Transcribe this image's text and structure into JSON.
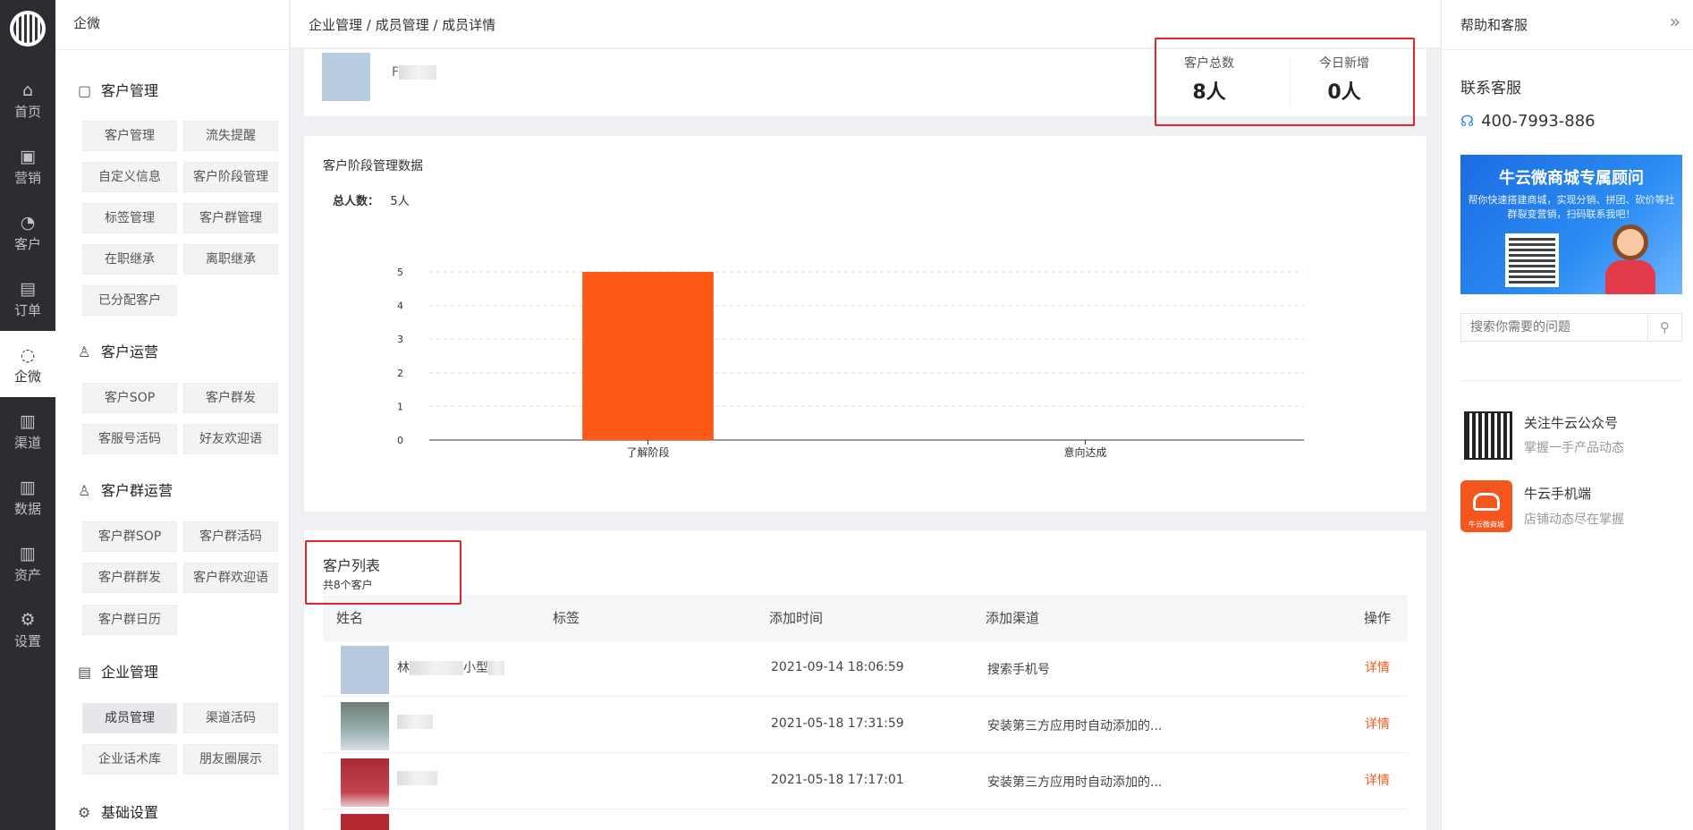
{
  "rail": {
    "items": [
      "首页",
      "营销",
      "客户",
      "订单",
      "企微",
      "渠道",
      "数据",
      "资产",
      "设置"
    ]
  },
  "menu": {
    "title": "企微",
    "groups": [
      {
        "title": "客户管理",
        "items": [
          "客户管理",
          "流失提醒",
          "自定义信息",
          "客户阶段管理",
          "标签管理",
          "客户群管理",
          "在职继承",
          "离职继承",
          "已分配客户"
        ]
      },
      {
        "title": "客户运营",
        "items": [
          "客户SOP",
          "客户群发",
          "客服号活码",
          "好友欢迎语"
        ]
      },
      {
        "title": "客户群运营",
        "items": [
          "客户群SOP",
          "客户群活码",
          "客户群群发",
          "客户群欢迎语",
          "客户群日历"
        ]
      },
      {
        "title": "企业管理",
        "items": [
          "成员管理",
          "渠道活码",
          "企业话术库",
          "朋友圈展示"
        ]
      },
      {
        "title": "基础设置",
        "items": []
      }
    ]
  },
  "breadcrumb": "企业管理 / 成员管理 / 成员详情",
  "member": {
    "name_initial": "F"
  },
  "stats": {
    "total_label": "客户总数",
    "total_value": "8人",
    "today_label": "今日新增",
    "today_value": "0人"
  },
  "stage_card": {
    "title": "客户阶段管理数据",
    "total_label": "总人数：",
    "total_value": "5人"
  },
  "chart_data": {
    "type": "bar",
    "categories": [
      "了解阶段",
      "意向达成"
    ],
    "values": [
      5,
      0
    ],
    "ylim": [
      0,
      5
    ],
    "yticks": [
      "0",
      "1",
      "2",
      "3",
      "4",
      "5"
    ],
    "grid": true,
    "bar_color": "#fc5a16"
  },
  "customer_list": {
    "title": "客户列表",
    "subtitle": "共8个客户",
    "columns": [
      "姓名",
      "标签",
      "添加时间",
      "添加渠道",
      "操作"
    ],
    "rows": [
      {
        "name": "林",
        "name_suffix": "小型",
        "time": "2021-09-14 18:06:59",
        "channel": "搜索手机号",
        "action": "详情"
      },
      {
        "name": "",
        "name_suffix": "",
        "time": "2021-05-18 17:31:59",
        "channel": "安装第三方应用时自动添加的...",
        "action": "详情"
      },
      {
        "name": "",
        "name_suffix": "",
        "time": "2021-05-18 17:17:01",
        "channel": "安装第三方应用时自动添加的...",
        "action": "详情"
      }
    ]
  },
  "help": {
    "title": "帮助和客服",
    "collapse": "»",
    "contact_title": "联系客服",
    "phone": "400-7993-886",
    "banner_title": "牛云微商城专属顾问",
    "banner_text": "帮你快速搭建商城，实现分销、拼团、砍价等社群裂变营销，扫码联系我吧！",
    "search_placeholder": "搜索你需要的问题",
    "follow_title": "关注牛云公众号",
    "follow_sub": "掌握一手产品动态",
    "app_title": "牛云手机端",
    "app_sub": "店铺动态尽在掌握",
    "app_icon_text": "牛云微商城"
  }
}
